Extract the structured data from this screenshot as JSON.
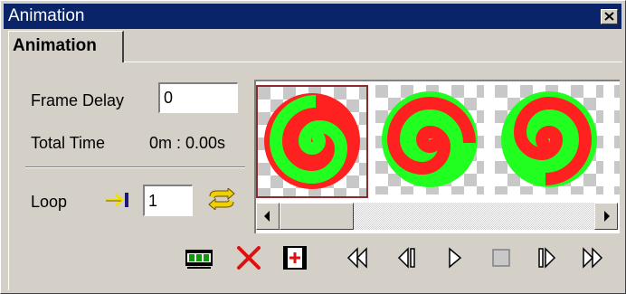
{
  "window": {
    "title": "Animation"
  },
  "tabs": [
    {
      "label": "Animation",
      "active": true
    }
  ],
  "frame_delay": {
    "label": "Frame Delay",
    "value": "0"
  },
  "total_time": {
    "label": "Total Time",
    "value": "0m : 0.00s"
  },
  "loop": {
    "label": "Loop",
    "value": "1"
  },
  "frames": [
    {
      "index": 1,
      "selected": true
    },
    {
      "index": 2,
      "selected": false
    },
    {
      "index": 3,
      "selected": false
    },
    {
      "index": 4,
      "selected": false
    }
  ],
  "toolbar": {
    "edit_tools": [
      "filmstrip-icon",
      "delete-icon",
      "add-frame-icon"
    ],
    "playback": [
      "rewind-icon",
      "previous-frame-icon",
      "play-icon",
      "stop-icon",
      "next-frame-icon",
      "fast-forward-icon"
    ]
  },
  "colors": {
    "titlebar": "#0a246a",
    "spiral_red": "#ff2020",
    "spiral_green": "#20ff20",
    "selection": "#8b2b2b"
  }
}
